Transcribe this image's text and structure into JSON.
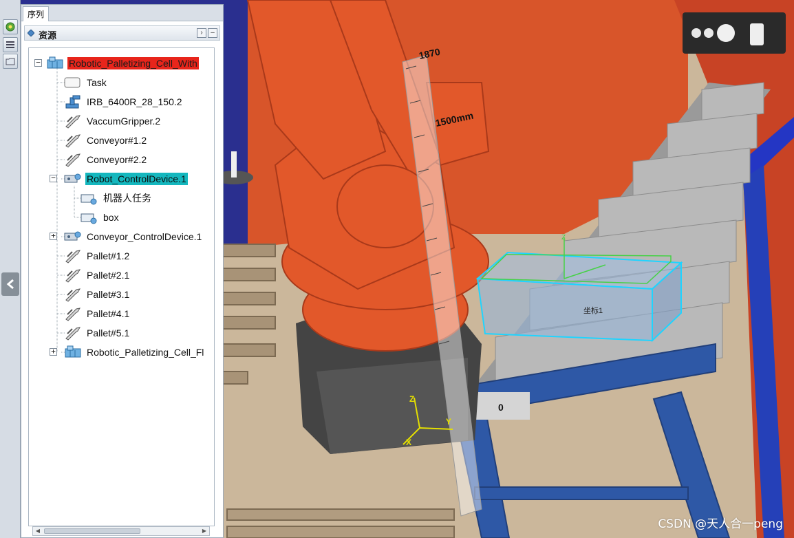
{
  "panel": {
    "tab_label": "序列",
    "header_title": "资源"
  },
  "tree": {
    "root": "Robotic_Palletizing_Cell_With",
    "items": [
      {
        "label": "Task",
        "icon": "task-icon"
      },
      {
        "label": "IRB_6400R_28_150.2",
        "icon": "robot-icon"
      },
      {
        "label": "VaccumGripper.2",
        "icon": "tool-icon"
      },
      {
        "label": "Conveyor#1.2",
        "icon": "tool-icon"
      },
      {
        "label": "Conveyor#2.2",
        "icon": "tool-icon"
      },
      {
        "label": "Robot_ControlDevice.1",
        "icon": "control-device-icon"
      },
      {
        "label": "机器人任务",
        "icon": "program-icon"
      },
      {
        "label": "box",
        "icon": "program-icon"
      },
      {
        "label": "Conveyor_ControlDevice.1",
        "icon": "control-device-icon"
      },
      {
        "label": "Pallet#1.2",
        "icon": "tool-icon"
      },
      {
        "label": "Pallet#2.1",
        "icon": "tool-icon"
      },
      {
        "label": "Pallet#3.1",
        "icon": "tool-icon"
      },
      {
        "label": "Pallet#4.1",
        "icon": "tool-icon"
      },
      {
        "label": "Pallet#5.1",
        "icon": "tool-icon"
      },
      {
        "label": "Robotic_Palletizing_Cell_Fl",
        "icon": "cell-icon"
      }
    ]
  },
  "viewport": {
    "ruler_top_label": "1870",
    "ruler_mid_label": "1500mm",
    "ruler_zero_label": "0",
    "axis_z": "Z",
    "axis_y": "Y",
    "axis_x": "X",
    "box_frame_label": "坐标1",
    "watermark": "CSDN @天人合一peng"
  },
  "colors": {
    "robot_orange": "#e2582a",
    "wall_orange": "#d8552a",
    "selection_red": "#e8251b",
    "selection_cyan": "#14b7be",
    "floor": "#cbb79b",
    "conveyor_blue": "#2e58a6"
  }
}
